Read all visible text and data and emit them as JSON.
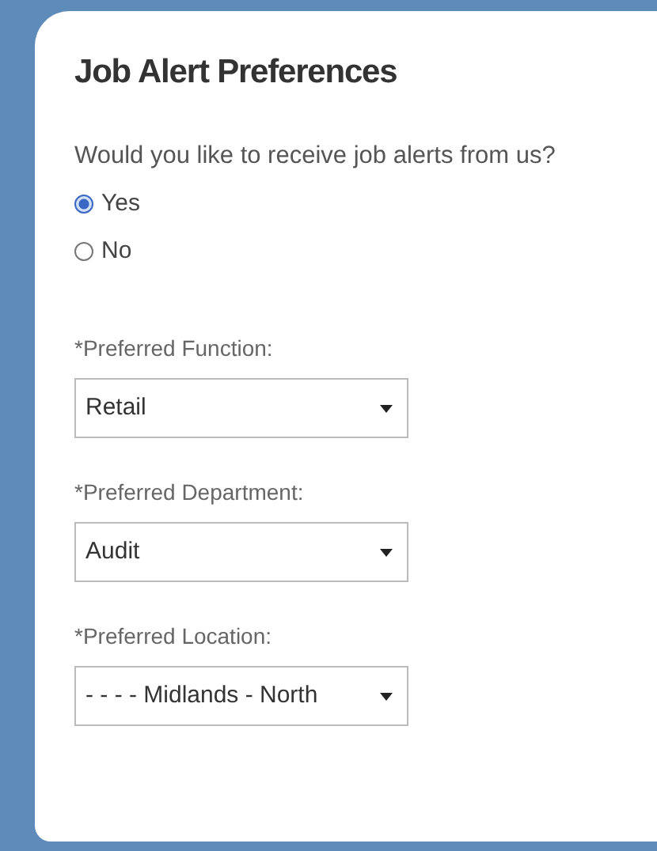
{
  "title": "Job Alert Preferences",
  "question": "Would you like to receive job alerts from us?",
  "options": [
    {
      "label": "Yes",
      "selected": true
    },
    {
      "label": "No",
      "selected": false
    }
  ],
  "fields": [
    {
      "label": "*Preferred Function:",
      "value": "Retail"
    },
    {
      "label": "*Preferred Department:",
      "value": "Audit"
    },
    {
      "label": "*Preferred Location:",
      "value": "- - - - Midlands - North"
    }
  ]
}
